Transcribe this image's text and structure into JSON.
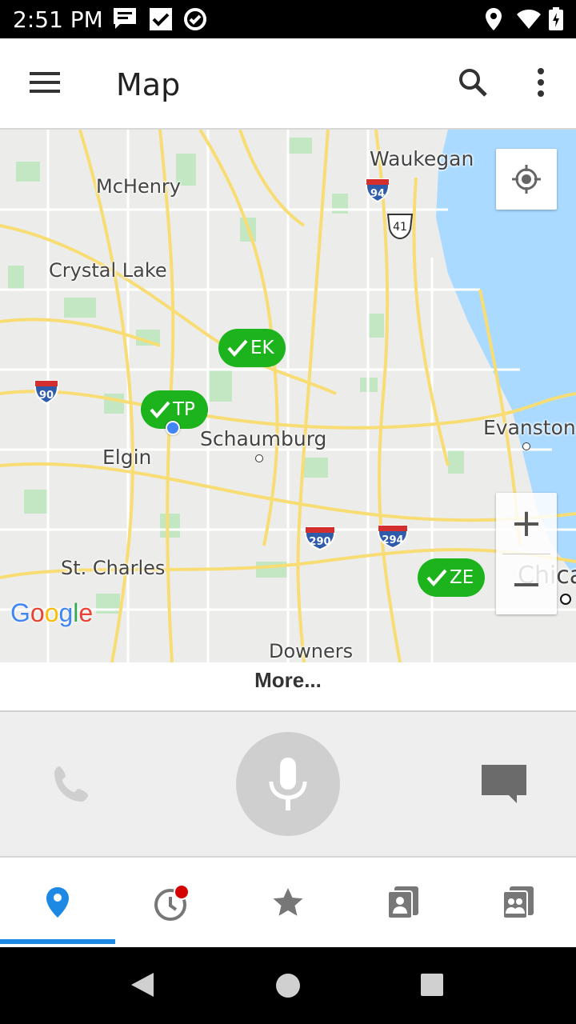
{
  "status_bar": {
    "time": "2:51 PM"
  },
  "app_bar": {
    "title": "Map"
  },
  "map": {
    "cities": {
      "waukegan": "Waukegan",
      "mchenry": "McHenry",
      "crystal_lake": "Crystal Lake",
      "elgin": "Elgin",
      "schaumburg": "Schaumburg",
      "evanston": "Evanston",
      "st_charles": "St. Charles",
      "downers": "Downers",
      "chicago": "Chica"
    },
    "highways": {
      "i94": "94",
      "us41": "41",
      "i90": "90",
      "i290": "290",
      "i294": "294"
    },
    "markers": {
      "ek": "EK",
      "tp": "TP",
      "ze": "ZE"
    },
    "zoom_in": "+",
    "zoom_out": "−",
    "google_logo": "Google"
  },
  "more_label": "More...",
  "colors": {
    "marker_green": "#1db31d",
    "accent_blue": "#1e88e5",
    "notification_red": "#d50000"
  }
}
